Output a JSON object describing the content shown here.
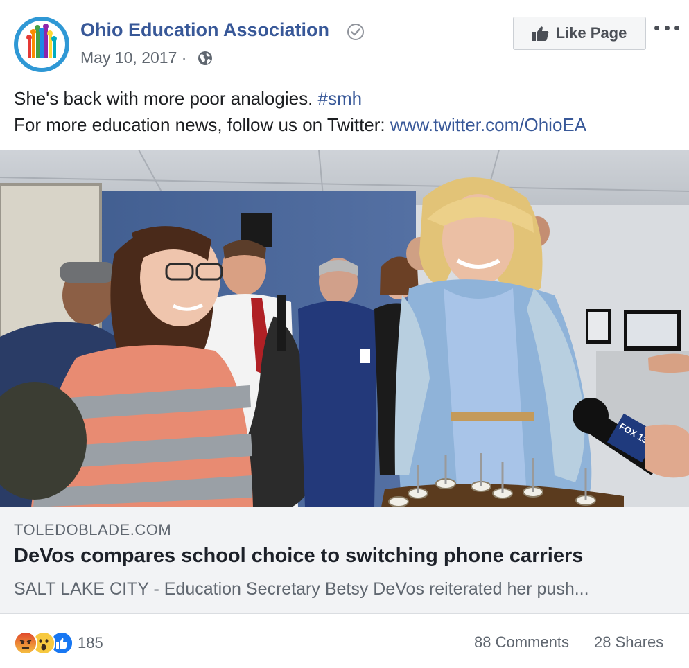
{
  "post": {
    "page_name": "Ohio Education Association",
    "date": "May 10, 2017 ·",
    "like_page_label": "Like Page",
    "text_line1": "She's back with more poor analogies.",
    "hashtag": "#smh",
    "text_line2": "For more education news, follow us on Twitter:",
    "twitter_link": "www.twitter.com/OhioEA"
  },
  "link_preview": {
    "domain": "TOLEDOBLADE.COM",
    "headline": "DeVos compares school choice to switching phone carriers",
    "description": "SALT LAKE CITY - Education Secretary Betsy DeVos reiterated her push..."
  },
  "stats": {
    "reaction_count": "185",
    "comments": "88 Comments",
    "shares": "28 Shares"
  },
  "photo": {
    "microphone_logo_text": "FOX 13"
  },
  "icons": {
    "verified": "verified-badge-icon",
    "audience": "globe-icon",
    "like": "thumbs-up-icon",
    "menu": "more-options-icon",
    "reactions": [
      "angry-reaction-icon",
      "wow-reaction-icon",
      "like-reaction-icon"
    ]
  },
  "colors": {
    "link_blue": "#385898",
    "meta_gray": "#606770",
    "like_blue": "#1877f2",
    "avatar_ring": "#2f98d5"
  }
}
